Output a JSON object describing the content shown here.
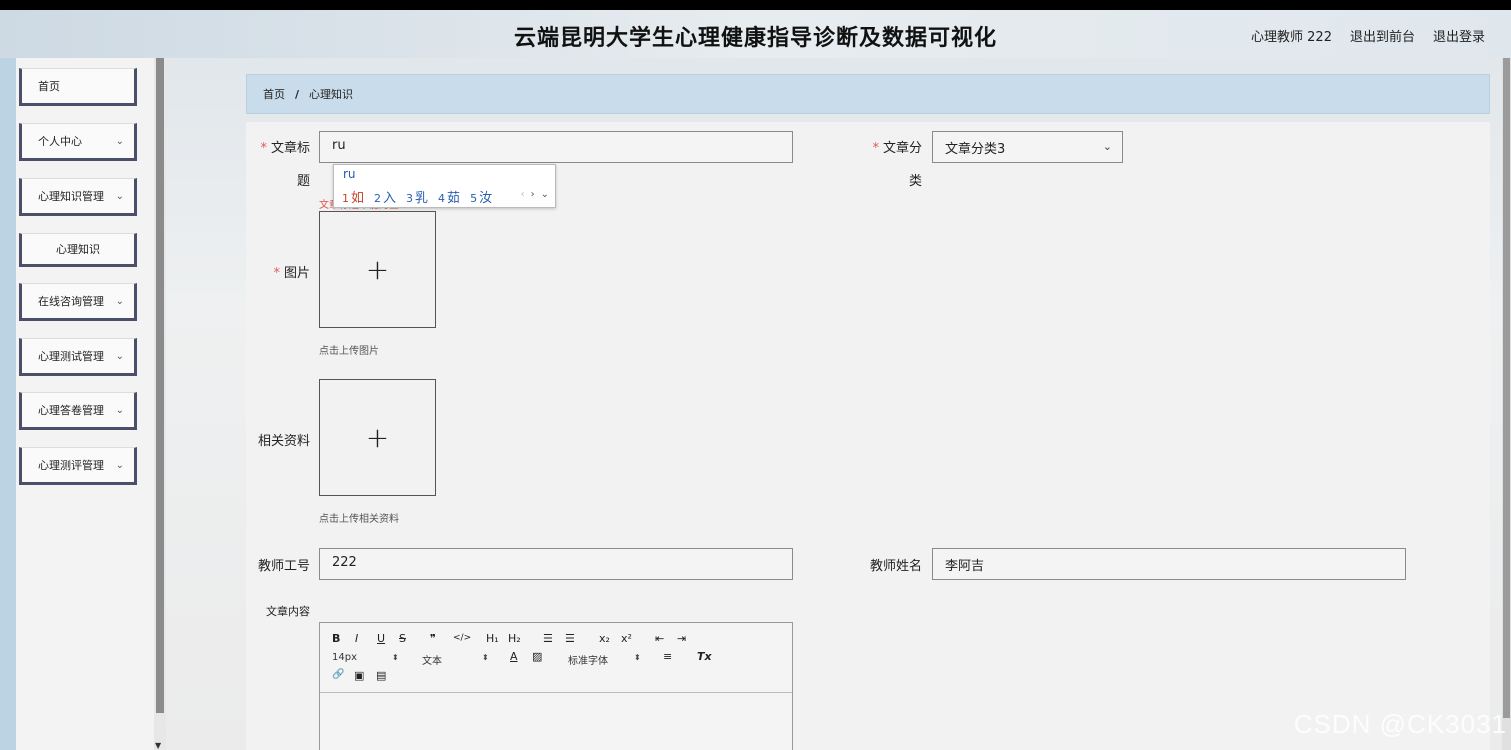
{
  "header": {
    "title": "云端昆明大学生心理健康指导诊断及数据可视化",
    "user": "心理教师 222",
    "to_front": "退出到前台",
    "logout": "退出登录"
  },
  "sidebar": {
    "items": [
      {
        "label": "首页",
        "chevron": ""
      },
      {
        "label": "个人中心",
        "chevron": "⌄"
      },
      {
        "label": "心理知识管理",
        "chevron": "⌄"
      },
      {
        "label": "心理知识",
        "chevron": ""
      },
      {
        "label": "在线咨询管理",
        "chevron": "⌄"
      },
      {
        "label": "心理测试管理",
        "chevron": "⌄"
      },
      {
        "label": "心理答卷管理",
        "chevron": "⌄"
      },
      {
        "label": "心理测评管理",
        "chevron": "⌄"
      }
    ]
  },
  "breadcrumb": {
    "home": "首页",
    "separator": "/",
    "current": "心理知识"
  },
  "form": {
    "title_label_line1": "文章标",
    "title_label_line2": "题",
    "title_value": "ru",
    "title_error": "文章标题不能为空",
    "category_label_line1": "文章分",
    "category_label_line2": "类",
    "category_value": "文章分类3",
    "image_label": "图片",
    "image_hint": "点击上传图片",
    "file_label": "相关资料",
    "file_hint": "点击上传相关资料",
    "teacher_id_label": "教师工号",
    "teacher_id_value": "222",
    "teacher_name_label": "教师姓名",
    "teacher_name_value": "李阿吉",
    "content_label": "文章内容",
    "required_mark": "*",
    "upload_plus": "+"
  },
  "ime": {
    "composition": "ru",
    "candidates": [
      {
        "num": "1",
        "text": "如"
      },
      {
        "num": "2",
        "text": "入"
      },
      {
        "num": "3",
        "text": "乳"
      },
      {
        "num": "4",
        "text": "茹"
      },
      {
        "num": "5",
        "text": "汝"
      }
    ],
    "nav_prev": "‹",
    "nav_next": "›",
    "nav_more": "⌄"
  },
  "editor": {
    "bold": "B",
    "italic": "I",
    "underline": "U",
    "strike": "S",
    "quote": "❞",
    "code": "</>",
    "h1": "H₁",
    "h2": "H₂",
    "ordered_list": "☰",
    "bullet_list": "☰",
    "subscript": "x₂",
    "superscript": "x²",
    "outdent": "⇤",
    "indent": "⇥",
    "size": "14px",
    "font_type": "文本",
    "text_color": "A",
    "bg_color": "▨",
    "font_family": "标准字体",
    "align": "≡",
    "clear_format": "Tx",
    "link": "🔗",
    "image": "▣",
    "video": "▤",
    "select_arrow": "⬍"
  },
  "watermark": "CSDN @CK3031"
}
